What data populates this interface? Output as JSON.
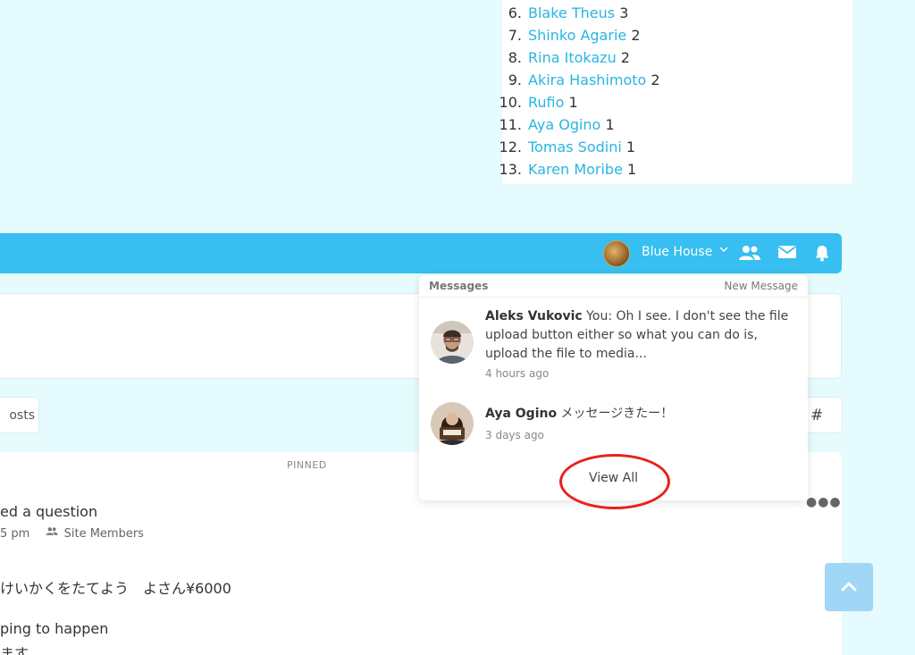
{
  "leaderboard": {
    "items": [
      {
        "rank": "6.",
        "name": "Blake Theus",
        "count": "3"
      },
      {
        "rank": "7.",
        "name": "Shinko Agarie",
        "count": "2"
      },
      {
        "rank": "8.",
        "name": "Rina Itokazu",
        "count": "2"
      },
      {
        "rank": "9.",
        "name": "Akira Hashimoto",
        "count": "2"
      },
      {
        "rank": "10.",
        "name": "Rufio",
        "count": "1"
      },
      {
        "rank": "11.",
        "name": "Aya Ogino",
        "count": "1"
      },
      {
        "rank": "12.",
        "name": "Tomas Sodini",
        "count": "1"
      },
      {
        "rank": "13.",
        "name": "Karen Moribe",
        "count": "1"
      }
    ]
  },
  "topbar": {
    "group_name": "Blue House",
    "icons": [
      "chevron-down-icon",
      "members-icon",
      "mail-icon",
      "bell-icon"
    ],
    "bar_color": "#36bff0"
  },
  "filters": {
    "posts_label": "osts",
    "hash_label": "#"
  },
  "post": {
    "pinned_label": "PINNED",
    "title_fragment": "ed a question",
    "time_fragment": "5 pm",
    "audience": "Site Members",
    "body_line1": "けいかくをたてよう　よさん¥6000",
    "body_line2": "ping to happen",
    "body_line3": "ます。",
    "more_icon": "more-dots-icon"
  },
  "messages": {
    "header_title": "Messages",
    "new_message_label": "New Message",
    "items": [
      {
        "sender": "Aleks Vukovic",
        "preview": " You: Oh I see. I don't see the file upload button either so what you can do is, upload the file to media...",
        "time": "4 hours ago"
      },
      {
        "sender": "Aya Ogino",
        "preview": " メッセージきたー！",
        "time": "3 days ago"
      }
    ],
    "view_all_label": "View All",
    "highlight_color": "#e8211b"
  },
  "scroll_top": {
    "icon": "chevron-up-icon",
    "color": "#a0d6f6"
  }
}
